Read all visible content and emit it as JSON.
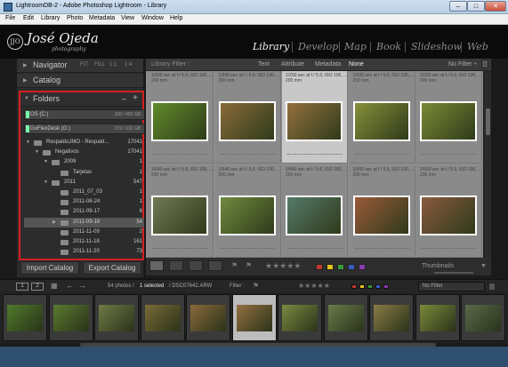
{
  "window": {
    "title": "LightroomDB-2 - Adobe Photoshop Lightroom - Library",
    "buttons": [
      "–",
      "□",
      "✕"
    ]
  },
  "menu": [
    "File",
    "Edit",
    "Library",
    "Photo",
    "Metadata",
    "View",
    "Window",
    "Help"
  ],
  "identity": {
    "badge": "JJO",
    "name": "José Ojeda",
    "sub": "photography"
  },
  "modules": [
    {
      "label": "Library",
      "active": true
    },
    {
      "label": "Develop"
    },
    {
      "label": "Map"
    },
    {
      "label": "Book"
    },
    {
      "label": "Slideshow"
    },
    {
      "label": "Web"
    }
  ],
  "left_panel": {
    "navigator": {
      "label": "Navigator",
      "options": [
        "FIT",
        "FILL",
        "1:1",
        "1:4"
      ]
    },
    "catalog": {
      "label": "Catalog"
    },
    "folders": {
      "label": "Folders",
      "actions": [
        "–",
        "+"
      ],
      "volumes": [
        {
          "name": "OS (C:)",
          "size": "106 / 450 GB"
        },
        {
          "name": "GoFlexDesk (G:)",
          "size": "219 / 932 GB"
        }
      ],
      "rows": [
        {
          "name": "RespaldoJMO - Respald...",
          "count": "17041",
          "indent": 0,
          "arrow": "▼"
        },
        {
          "name": "Negativos",
          "count": "17041",
          "indent": 1,
          "arrow": "▼"
        },
        {
          "name": "2009",
          "count": "1",
          "indent": 2,
          "arrow": "▼"
        },
        {
          "name": "Tarjetas",
          "count": "1",
          "indent": 3,
          "arrow": ""
        },
        {
          "name": "2011",
          "count": "547",
          "indent": 2,
          "arrow": "▼"
        },
        {
          "name": "2011_07_03",
          "count": "1",
          "indent": 3,
          "arrow": ""
        },
        {
          "name": "2011-08-24",
          "count": "1",
          "indent": 3,
          "arrow": ""
        },
        {
          "name": "2011-09-17",
          "count": "6",
          "indent": 3,
          "arrow": ""
        },
        {
          "name": "2011-09-18",
          "count": "54",
          "indent": 3,
          "arrow": "▶",
          "selected": true
        },
        {
          "name": "2011-11-09",
          "count": "2",
          "indent": 3,
          "arrow": ""
        },
        {
          "name": "2011-11-18",
          "count": "161",
          "indent": 3,
          "arrow": ""
        },
        {
          "name": "2011-11-20",
          "count": "73",
          "indent": 3,
          "arrow": ""
        }
      ]
    },
    "import_label": "Import Catalog",
    "export_label": "Export Catalog"
  },
  "filter_bar": {
    "label": "Library Filter :",
    "tabs": [
      "Text",
      "Attribute",
      "Metadata",
      "None"
    ],
    "active": "None",
    "preset": "No Filter ÷"
  },
  "grid": {
    "cells": [
      {
        "info": "1/200 sec at f / 5.6, ISO 100, ...",
        "info2": "200 mm",
        "color": "#5f8a2a",
        "selected": false
      },
      {
        "info": "1/200 sec at f / 5.6, ISO 100, ...",
        "info2": "200 mm",
        "color": "#8a6a3a",
        "selected": false
      },
      {
        "info": "1/200 sec at f / 5.6, ISO 100, ...",
        "info2": "200 mm",
        "color": "#94703f",
        "selected": true
      },
      {
        "info": "1/200 sec at f / 5.6, ISO 100, ...",
        "info2": "200 mm",
        "color": "#86903a",
        "selected": false
      },
      {
        "info": "1/200 sec at f / 5.6, ISO 100, ...",
        "info2": "200 mm",
        "color": "#7a8a35",
        "selected": false
      },
      {
        "info": "1/640 sec at f / 5.6, ISO 100, ...",
        "info2": "200 mm",
        "color": "#6f7a55",
        "selected": false
      },
      {
        "info": "1/640 sec at f / 5.6, ISO 100, ...",
        "info2": "200 mm",
        "color": "#6f8a3f",
        "selected": false
      },
      {
        "info": "1/640 sec at f / 5.6, ISO 100, ...",
        "info2": "200 mm",
        "color": "#557a6a",
        "selected": false
      },
      {
        "info": "1/500 sec at f / 5.6, ISO 100, ...",
        "info2": "200 mm",
        "color": "#9a5a3a",
        "selected": false
      },
      {
        "info": "1/500 sec at f / 5.6, ISO 100, ...",
        "info2": "200 mm",
        "color": "#8a5a3f",
        "selected": false
      }
    ]
  },
  "toolbar": {
    "stars": "★★★★★",
    "color_labels": [
      "#c0392b",
      "#e3c21c",
      "#3a9a3a",
      "#3a5bc0",
      "#8a3ab0"
    ],
    "thumbnails_label": "Thumbnails"
  },
  "filmstrip_bar": {
    "pages": [
      "1",
      "2"
    ],
    "status_count": "54 photos / ",
    "status_selected": "1 selected",
    "status_file": " / DSC07642.ARW",
    "filter_label": "Filter :",
    "no_filter": "No Filter"
  },
  "filmstrip": [
    {
      "color": "#4e7a2a"
    },
    {
      "color": "#5a7a30"
    },
    {
      "color": "#6f7a45"
    },
    {
      "color": "#7a6a35"
    },
    {
      "color": "#8a6a3a"
    },
    {
      "color": "#94703f",
      "selected": true
    },
    {
      "color": "#7a8a40"
    },
    {
      "color": "#6a7a4a"
    },
    {
      "color": "#8a7a45"
    },
    {
      "color": "#7a8a3a"
    },
    {
      "color": "#5a6a4a"
    }
  ]
}
